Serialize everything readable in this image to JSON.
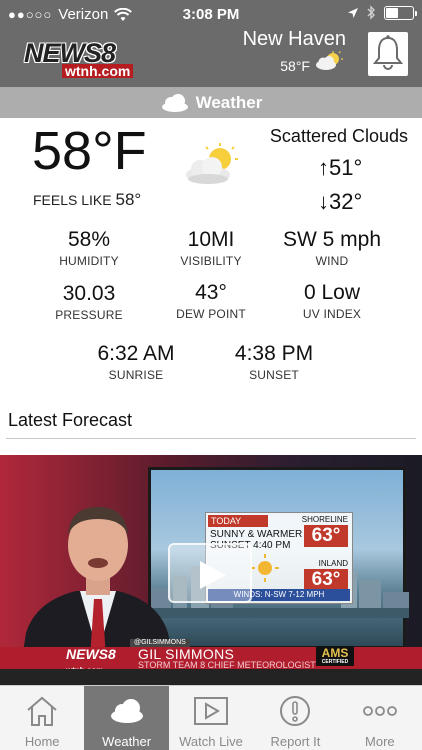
{
  "status_bar": {
    "signal_dots": "●●○○○",
    "carrier": "Verizon",
    "time": "3:08 PM",
    "battery_level": 0.5
  },
  "header": {
    "logo_text": "NEWS8",
    "logo_site": "wtnh.com",
    "city": "New Haven",
    "city_temp": "58°F",
    "city_icon": "partly-cloudy-icon",
    "bell_icon": "bell-icon"
  },
  "section": {
    "title": "Weather",
    "icon": "cloud-icon"
  },
  "current": {
    "temperature": "58°F",
    "feels_like_label": "FEELS LIKE",
    "feels_like_value": "58°",
    "condition": "Scattered Clouds",
    "condition_icon": "partly-cloudy-icon",
    "high": "↑51°",
    "low": "↓32°"
  },
  "metrics": {
    "humidity": {
      "value": "58%",
      "label": "HUMIDITY"
    },
    "visibility": {
      "value": "10MI",
      "label": "VISIBILITY"
    },
    "wind": {
      "value": "SW 5 mph",
      "label": "WIND"
    },
    "pressure": {
      "value": "30.03",
      "label": "PRESSURE"
    },
    "dew_point": {
      "value": "43°",
      "label": "DEW POINT"
    },
    "uv_index": {
      "value": "0 Low",
      "label": "UV INDEX"
    },
    "sunrise": {
      "value": "6:32 AM",
      "label": "SUNRISE"
    },
    "sunset": {
      "value": "4:38 PM",
      "label": "SUNSET"
    }
  },
  "forecast": {
    "heading": "Latest Forecast",
    "video": {
      "card_today": "TODAY",
      "card_line1": "SUNNY & WARMER",
      "card_line2": "SUNSET 4:40 PM",
      "card_shoreline": "SHORELINE",
      "card_shoreline_temp": "63°",
      "card_inland": "INLAND",
      "card_inland_temp": "63°",
      "card_winds": "WINDS: N-SW 7-12 MPH",
      "name_tag": "@GILSIMMONS",
      "lower_logo": "NEWS8",
      "lower_logo_site": "wtnh.com",
      "lower_name": "GIL SIMMONS",
      "lower_title": "STORM TEAM 8 CHIEF METEOROLOGIST",
      "lower_badge": "AMS",
      "lower_badge_sub": "CERTIFIED",
      "play_icon": "play-icon"
    }
  },
  "tabs": [
    {
      "label": "Home",
      "icon": "home-icon",
      "active": false
    },
    {
      "label": "Weather",
      "icon": "cloud-icon",
      "active": true
    },
    {
      "label": "Watch Live",
      "icon": "play-icon",
      "active": false
    },
    {
      "label": "Report It",
      "icon": "exclamation-icon",
      "active": false
    },
    {
      "label": "More",
      "icon": "more-icon",
      "active": false
    }
  ]
}
